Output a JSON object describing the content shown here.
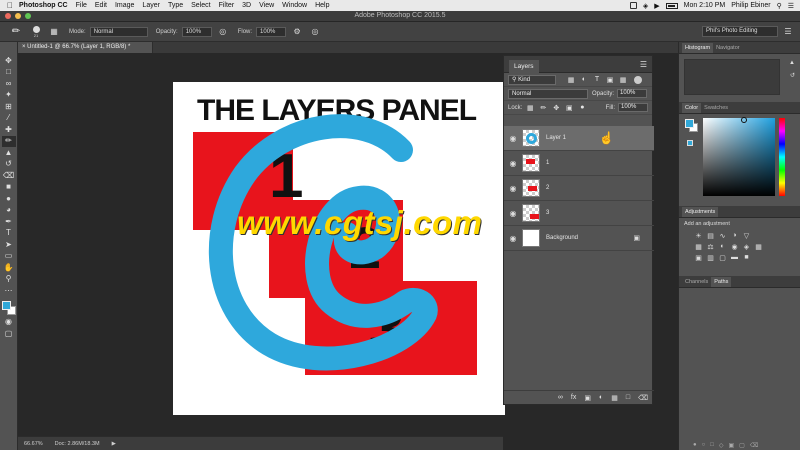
{
  "menubar": {
    "app_name": "Photoshop CC",
    "items": [
      "File",
      "Edit",
      "Image",
      "Layer",
      "Type",
      "Select",
      "Filter",
      "3D",
      "View",
      "Window",
      "Help"
    ],
    "clock": "Mon 2:10 PM",
    "user": "Philip Ebiner"
  },
  "window": {
    "title": "Adobe Photoshop CC 2015.5"
  },
  "options": {
    "brush_size": "21",
    "mode_label": "Mode:",
    "mode_value": "Normal",
    "opacity_label": "Opacity:",
    "opacity_value": "100%",
    "flow_label": "Flow:",
    "flow_value": "100%",
    "workspace": "Phil's Photo Editing"
  },
  "document": {
    "tab_title": "Untitled-1 @ 66.7% (Layer 1, RGB/8) *",
    "zoom": "66.67%",
    "doc_size": "Doc: 2.86M/18.3M"
  },
  "artwork": {
    "title": "THE LAYERS PANEL",
    "numbers": [
      "1",
      "2",
      "3"
    ],
    "colors": {
      "red": "#e8141c",
      "stroke": "#2ea8dc"
    }
  },
  "watermark": "www.cgtsj.com",
  "layers_panel": {
    "tab": "Layers",
    "filter_kind": "Kind",
    "blend_mode": "Normal",
    "opacity_label": "Opacity:",
    "opacity_value": "100%",
    "lock_label": "Lock:",
    "fill_label": "Fill:",
    "fill_value": "100%",
    "layers": [
      {
        "name": "Layer 1",
        "selected": true
      },
      {
        "name": "1",
        "selected": false
      },
      {
        "name": "2",
        "selected": false
      },
      {
        "name": "3",
        "selected": false
      },
      {
        "name": "Background",
        "selected": false,
        "locked": true
      }
    ]
  },
  "dock": {
    "histogram_tabs": [
      "Histogram",
      "Navigator"
    ],
    "color_tabs": [
      "Color",
      "Swatches"
    ],
    "adjustments_tab": "Adjustments",
    "add_adjustment": "Add an adjustment",
    "bottom_tabs": [
      "Channels",
      "Paths"
    ]
  },
  "accent_color": "#30a8d8"
}
